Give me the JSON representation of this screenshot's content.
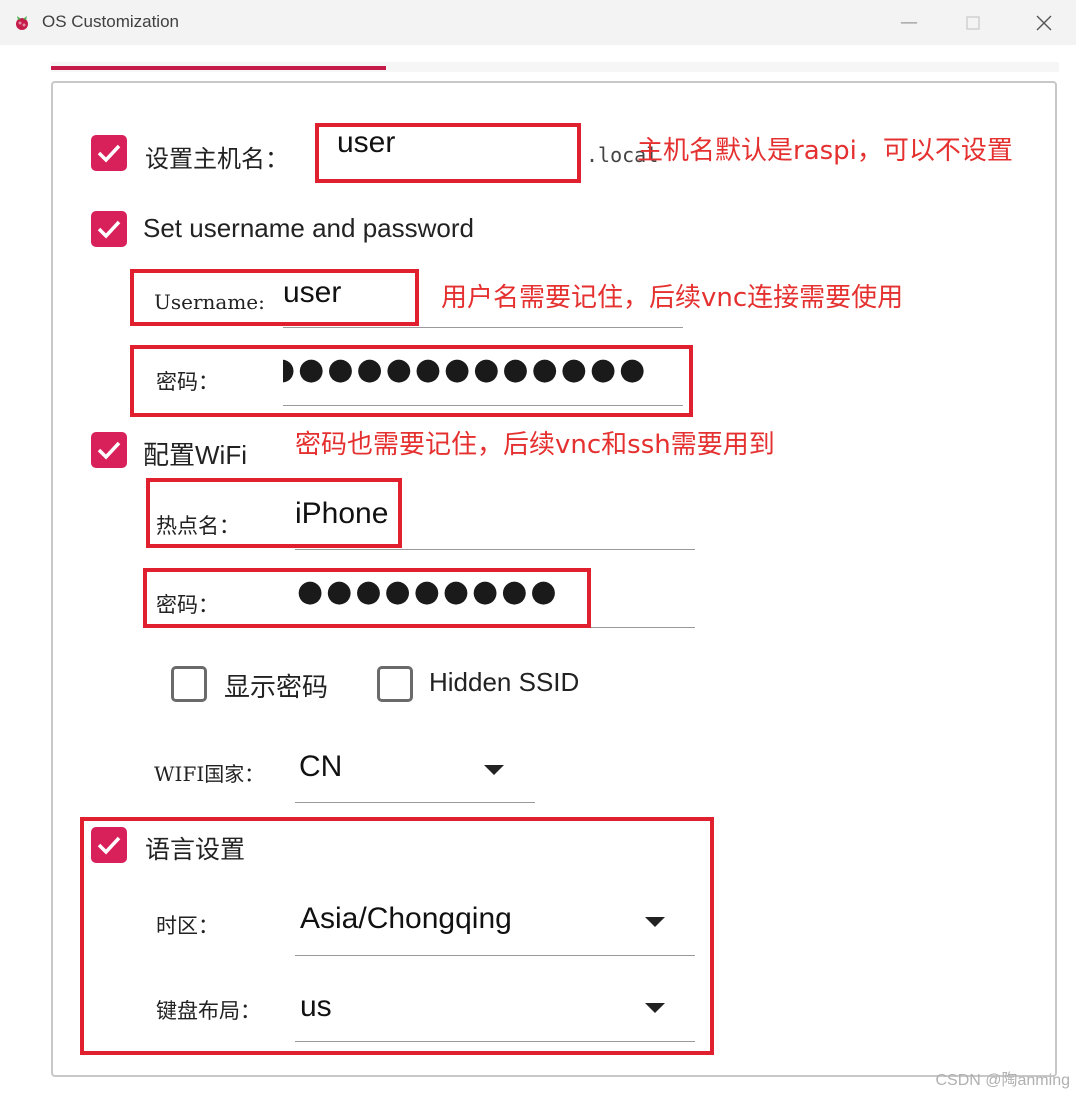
{
  "window": {
    "title": "OS Customization",
    "minimize_icon": "minimize-icon",
    "maximize_icon": "maximize-icon",
    "close_icon": "close-icon"
  },
  "colors": {
    "accent": "#c51a4a",
    "annotation": "#e0202e"
  },
  "hostname": {
    "checked": true,
    "label": "设置主机名：",
    "value": "user",
    "suffix": ".local",
    "note": "主机名默认是raspi，可以不设置"
  },
  "user": {
    "checked": true,
    "label": "Set username and password",
    "username_label": "Username:",
    "username_value": "user",
    "username_note": "用户名需要记住，后续vnc连接需要使用",
    "password_label": "密码：",
    "password_mask": "●●●●●●●●●●●●●",
    "password_note": "密码也需要记住，后续vnc和ssh需要用到"
  },
  "wifi": {
    "checked": true,
    "label": "配置WiFi",
    "ssid_label": "热点名：",
    "ssid_value": "iPhone",
    "password_label": "密码：",
    "password_mask": "●●●●●●●●●",
    "show_password_label": "显示密码",
    "show_password_checked": false,
    "hidden_ssid_label": "Hidden SSID",
    "hidden_ssid_checked": false,
    "country_label": "WIFI国家：",
    "country_value": "CN"
  },
  "locale": {
    "checked": true,
    "label": "语言设置",
    "timezone_label": "时区：",
    "timezone_value": "Asia/Chongqing",
    "keyboard_label": "键盘布局：",
    "keyboard_value": "us"
  },
  "watermark": "CSDN @陶anming"
}
